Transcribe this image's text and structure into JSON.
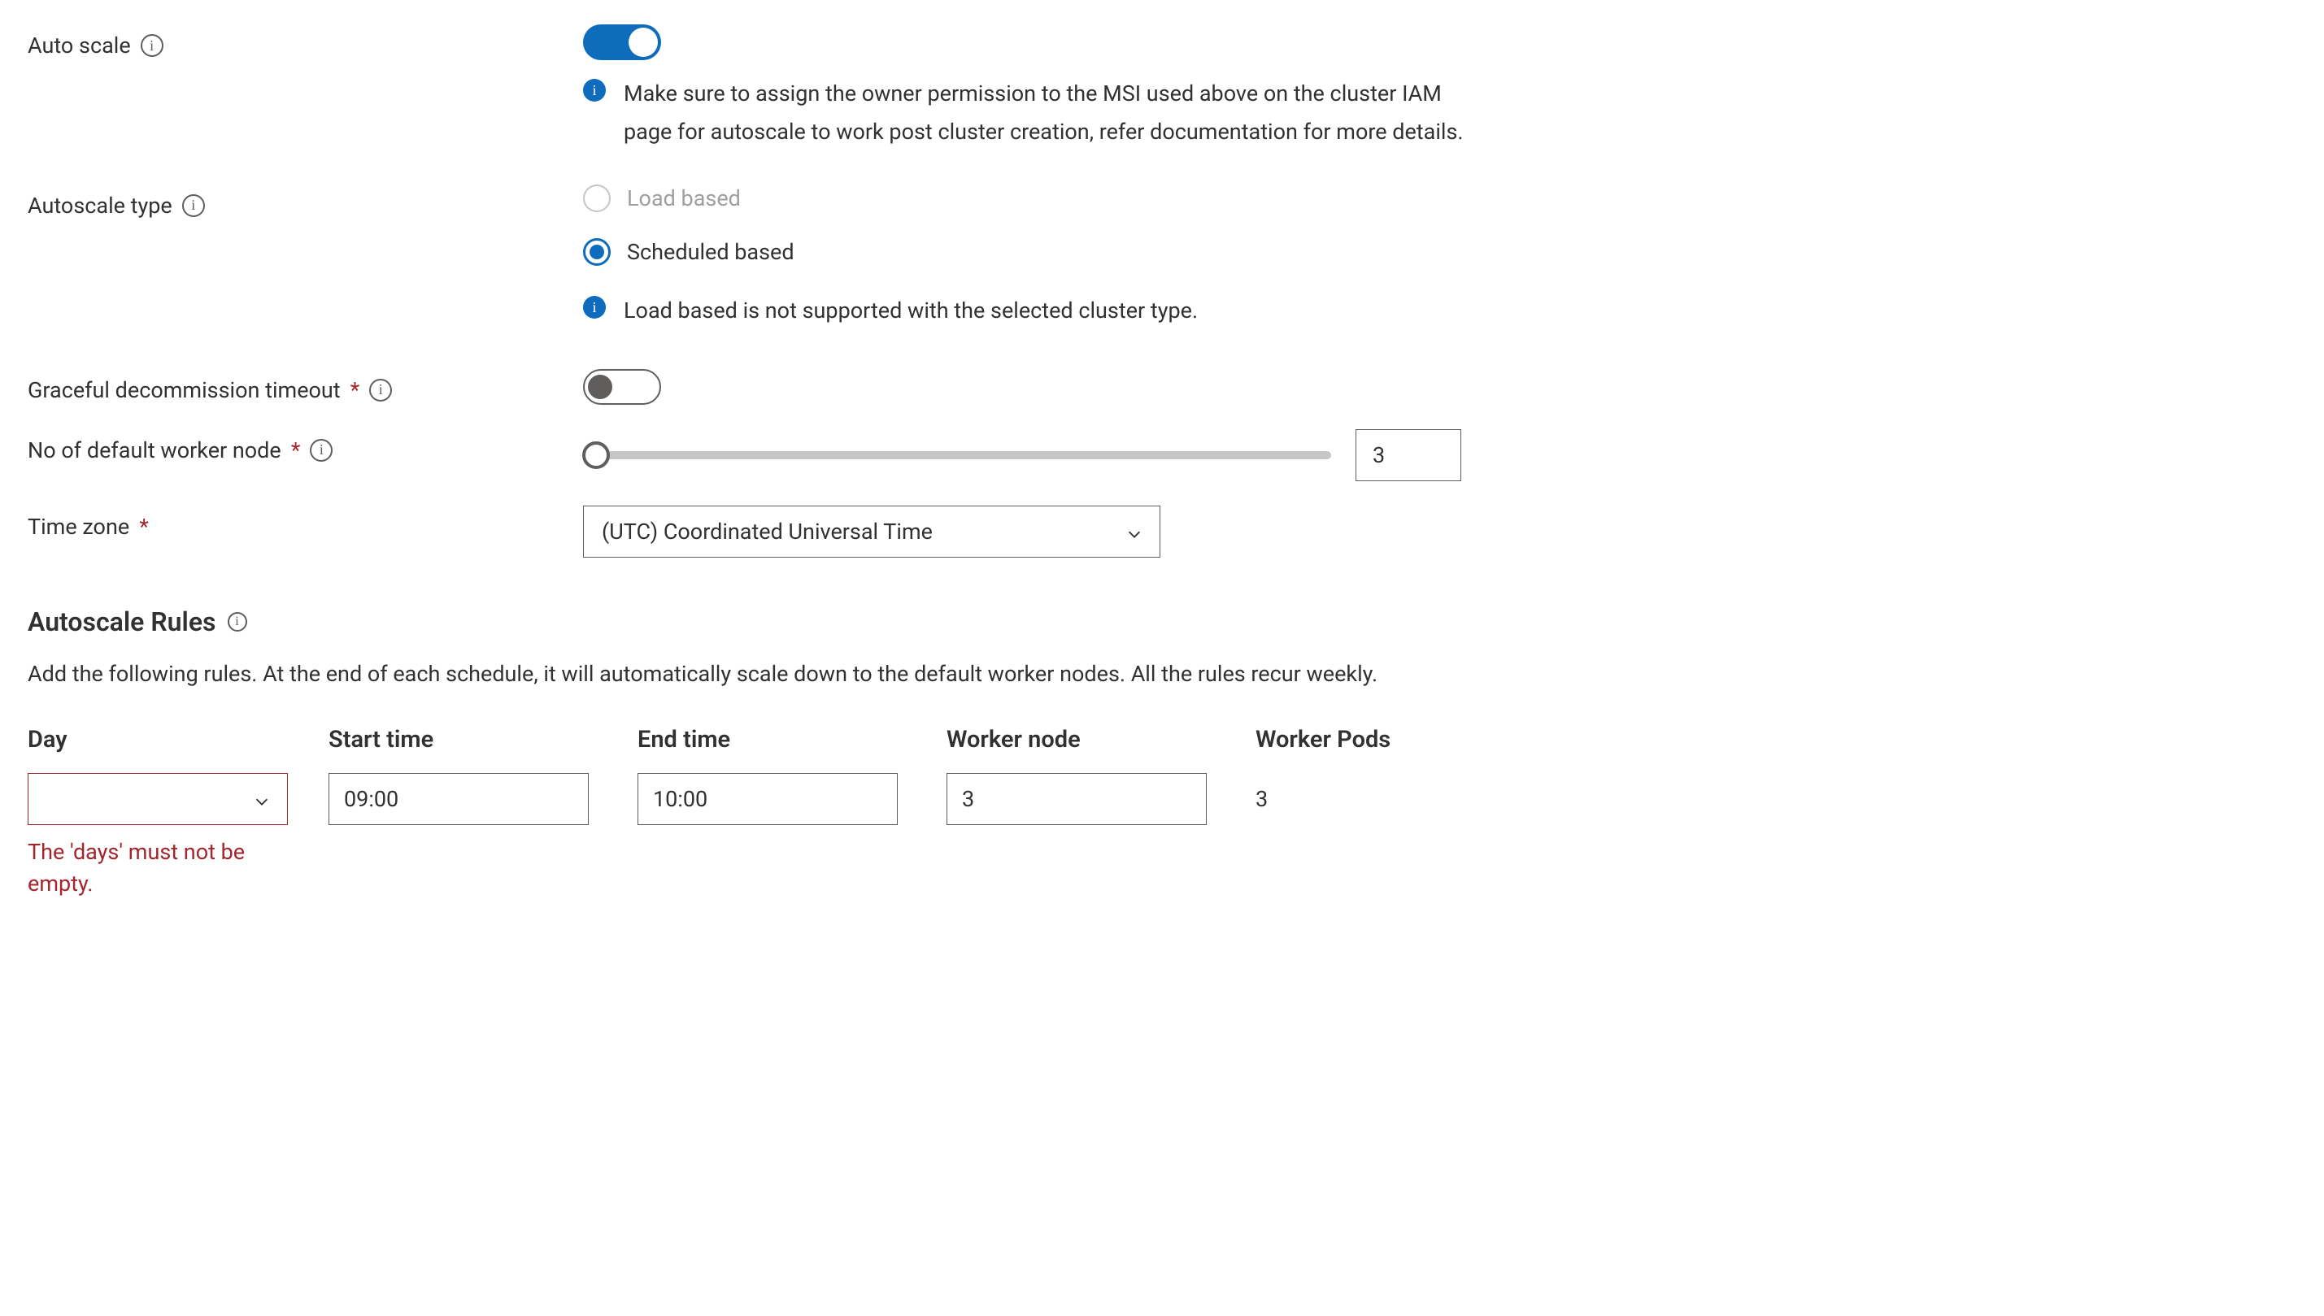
{
  "autoscale": {
    "label": "Auto scale",
    "info_msg": "Make sure to assign the owner permission to the MSI used above on the cluster IAM page for autoscale to work post cluster creation, refer documentation for more details."
  },
  "autoscale_type": {
    "label": "Autoscale type",
    "option_load": "Load based",
    "option_scheduled": "Scheduled based",
    "note": "Load based is not supported with the selected cluster type."
  },
  "graceful": {
    "label": "Graceful decommission timeout"
  },
  "worker_node": {
    "label": "No of default worker node",
    "value": "3"
  },
  "timezone": {
    "label": "Time zone",
    "value": "(UTC) Coordinated Universal Time"
  },
  "rules": {
    "heading": "Autoscale Rules",
    "desc": "Add the following rules. At the end of each schedule, it will automatically scale down to the default worker nodes. All the rules recur weekly.",
    "cols": {
      "day": "Day",
      "start": "Start time",
      "end": "End time",
      "wnode": "Worker node",
      "wpods": "Worker Pods"
    },
    "row": {
      "day": "",
      "start": "09:00",
      "end": "10:00",
      "wnode": "3",
      "wpods": "3"
    },
    "error": "The 'days' must not be empty."
  }
}
